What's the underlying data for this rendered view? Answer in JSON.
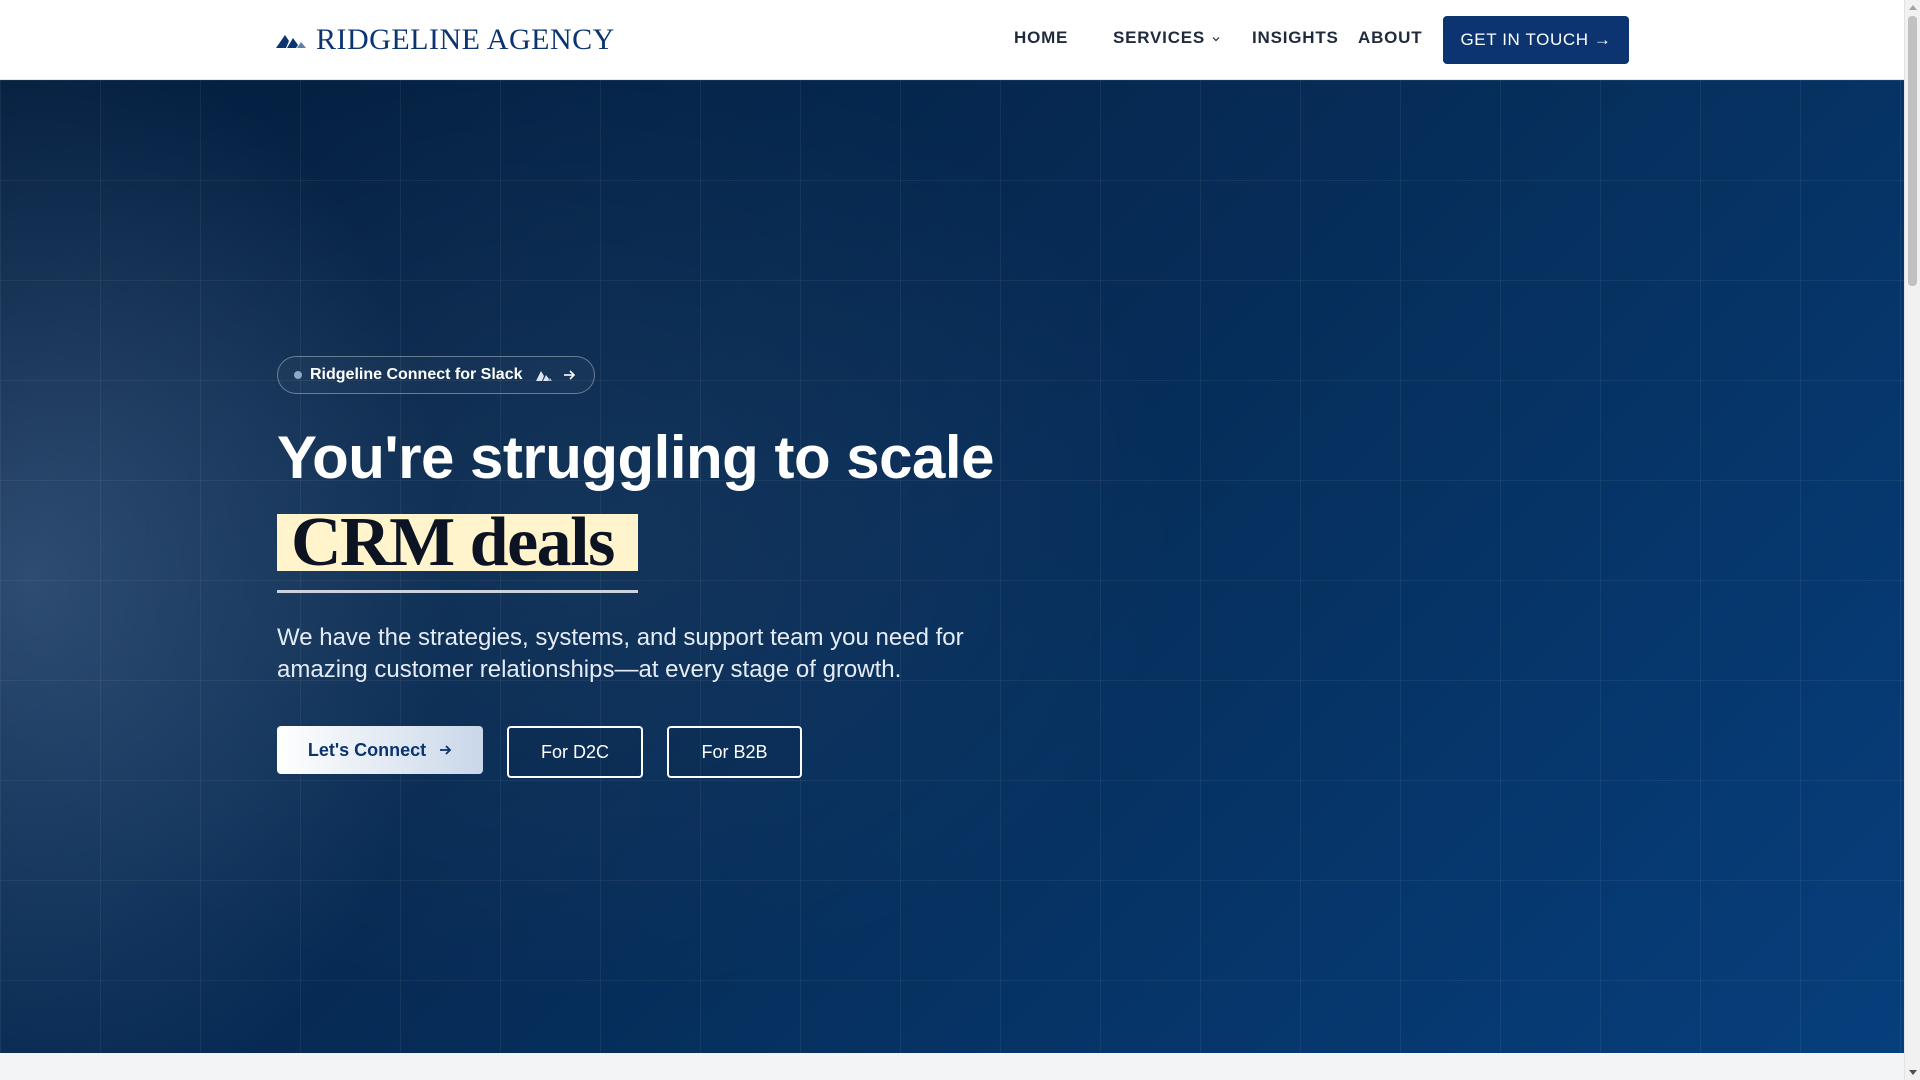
{
  "header": {
    "logo_text": "RIDGELINE AGENCY",
    "nav": [
      {
        "label": "HOME"
      },
      {
        "label": "SERVICES"
      },
      {
        "label": "INSIGHTS"
      },
      {
        "label": "ABOUT"
      }
    ],
    "cta_label": "GET IN TOUCH →"
  },
  "hero": {
    "badge_label": "Ridgeline Connect for Slack",
    "headline": "You're struggling to scale",
    "highlight": "CRM deals",
    "subtext": "We have the strategies, systems, and support team you need for amazing customer relationships—at every stage of growth.",
    "primary_button": "Let's Connect",
    "d2c_button": "For D2C",
    "b2b_button": "For B2B"
  },
  "colors": {
    "brand": "#0b3470",
    "hero_dark": "#031d3d",
    "hero_light": "#063f7d",
    "highlight": "#fff4cc"
  },
  "icons": {
    "logo": "mountain-peaks-icon",
    "services_dropdown": "chevron-down-icon",
    "badge_mark": "mountain-peaks-icon",
    "badge_arrow": "arrow-right-icon",
    "primary_arrow": "arrow-right-icon"
  }
}
